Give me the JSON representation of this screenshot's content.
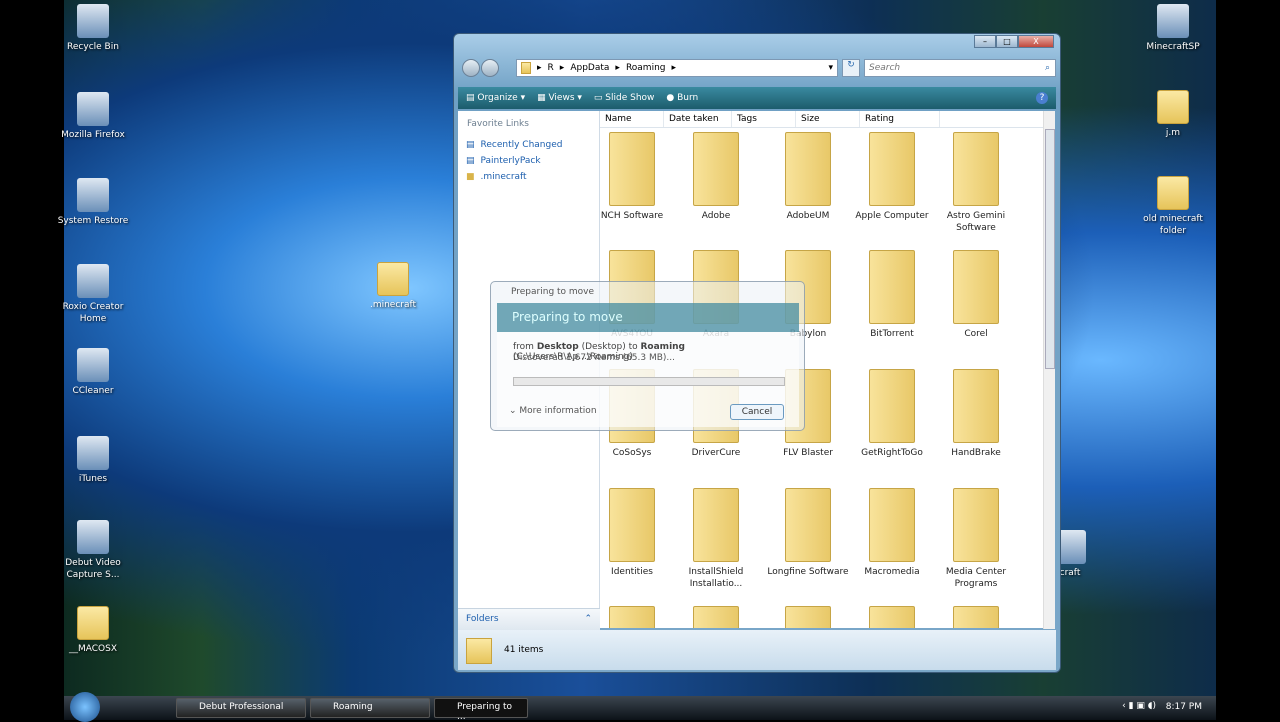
{
  "desktop": {
    "left_icons": [
      "Recycle Bin",
      "Mozilla Firefox",
      "System Restore",
      "Roxio Creator Home",
      "CCleaner",
      "iTunes",
      "Debut Video Capture S...",
      "__MACOSX"
    ],
    "middle_icon": ".minecraft",
    "right_icons": [
      "MinecraftSP",
      "j.m",
      "old minecraft folder"
    ],
    "partial_icon": "craft"
  },
  "explorer": {
    "breadcrumb": [
      "R",
      "AppData",
      "Roaming"
    ],
    "search_placeholder": "Search",
    "toolbar": [
      "Organize",
      "Views",
      "Slide Show",
      "Burn"
    ],
    "favorite_links_title": "Favorite Links",
    "favorite_links": [
      "Recently Changed",
      "PainterlyPack",
      ".minecraft"
    ],
    "folders_label": "Folders",
    "columns": [
      "Name",
      "Date taken",
      "Tags",
      "Size",
      "Rating"
    ],
    "items": [
      "NCH Software",
      "Adobe",
      "AdobeUM",
      "Apple Computer",
      "Astro Gemini Software",
      "AVS4YOU",
      "Axara",
      "Babylon",
      "BitTorrent",
      "Corel",
      "CoSoSys",
      "DriverCure",
      "FLV Blaster",
      "GetRightToGo",
      "HandBrake",
      "Identities",
      "InstallShield Installatio...",
      "Longfine Software",
      "Macromedia",
      "Media Center Programs",
      "",
      "",
      "",
      "",
      ""
    ],
    "status": "41 items"
  },
  "dialog": {
    "title": "Preparing to move",
    "heading": "Preparing to move",
    "from_word": "from",
    "src": "Desktop",
    "src_paren": "(Desktop)",
    "to_word": "to",
    "dst": "Roaming",
    "dst_paren": "(C:\\Users\\R\\Ap...\\Roaming)",
    "discovered": "Discovered 1,672 items (65.3 MB)...",
    "more": "More information",
    "cancel": "Cancel",
    "progress": 0
  },
  "taskbar": {
    "buttons": [
      "Debut Professional",
      "Roaming",
      "Preparing to ..."
    ],
    "clock": "8:17 PM"
  }
}
